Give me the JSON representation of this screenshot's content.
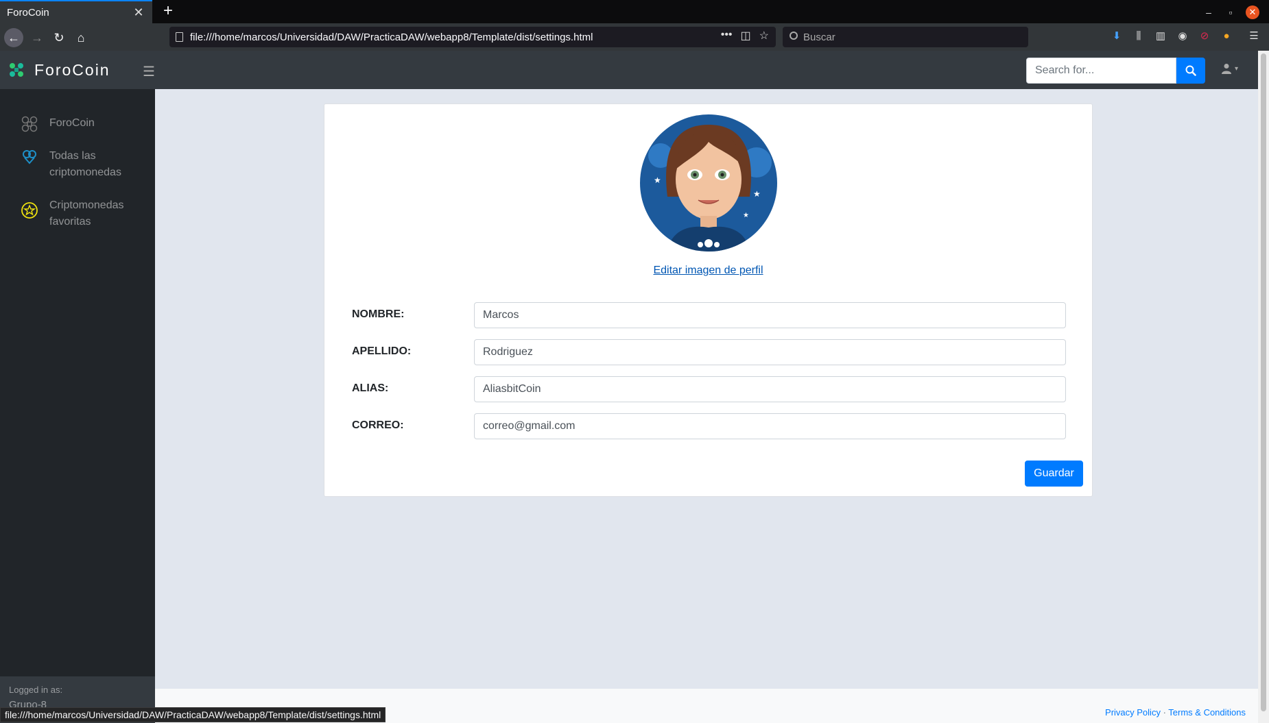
{
  "browser": {
    "tab_title": "ForoCoin",
    "url": "file:///home/marcos/Universidad/DAW/PracticaDAW/webapp8/Template/dist/settings.html",
    "search_placeholder": "Buscar",
    "status_url": "file:///home/marcos/Universidad/DAW/PracticaDAW/webapp8/Template/dist/settings.html",
    "new_tab_label": "+",
    "close_tab_label": "✕"
  },
  "app": {
    "brand": "ForoCoin",
    "search_placeholder": "Search for..."
  },
  "sidebar": {
    "items": [
      {
        "label": "ForoCoin",
        "icon": "forocoin-icon"
      },
      {
        "label": "Todas las criptomonedas",
        "icon": "crypto-icon"
      },
      {
        "label": "Criptomonedas favoritas",
        "icon": "star-icon"
      }
    ],
    "logged_in_label": "Logged in as:",
    "logged_in_user": "Grupo-8"
  },
  "profile": {
    "edit_image_label": "Editar imagen de perfil",
    "fields": [
      {
        "label": "NOMBRE:",
        "value": "Marcos"
      },
      {
        "label": "APELLIDO:",
        "value": "Rodriguez"
      },
      {
        "label": "ALIAS:",
        "value": "AliasbitCoin"
      },
      {
        "label": "CORREO:",
        "value": "correo@gmail.com"
      }
    ],
    "save_label": "Guardar"
  },
  "footer": {
    "privacy": "Privacy Policy",
    "separator": " · ",
    "terms": "Terms & Conditions"
  },
  "colors": {
    "primary": "#007bff",
    "sidebar_bg": "#212529",
    "nav_bg": "#343a40",
    "main_bg": "#e1e6ee"
  }
}
